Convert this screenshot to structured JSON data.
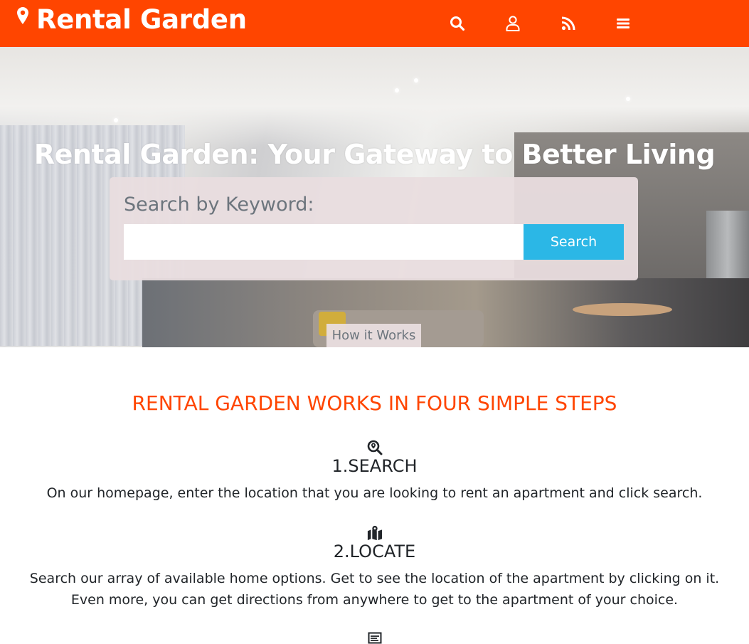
{
  "header": {
    "brand": "Rental Garden",
    "icons": [
      "map-pin-icon",
      "search-icon",
      "user-icon",
      "rss-icon",
      "menu-icon"
    ],
    "bg_color": "#ff4500"
  },
  "hero": {
    "title": "Rental Garden: Your Gateway to Better Living",
    "search_label": "Search by Keyword:",
    "search_value": "",
    "search_button": "Search",
    "how_tab": "How it Works"
  },
  "steps": {
    "heading": "RENTAL GARDEN WORKS IN FOUR SIMPLE STEPS",
    "heading_color": "#ff4500",
    "items": [
      {
        "icon": "search-location-icon",
        "title": "1.SEARCH",
        "description": "On our homepage, enter the location that you are looking to rent an apartment and click search."
      },
      {
        "icon": "map-marked-icon",
        "title": "2.LOCATE",
        "description": "Search our array of available home options. Get to see the location of the apartment by clicking on it. Even more, you can get directions from anywhere to get to the apartment of your choice."
      },
      {
        "icon": "rental-sign-icon",
        "title": "",
        "description": ""
      }
    ]
  },
  "colors": {
    "brand": "#ff4500",
    "button": "#2bb7e6"
  }
}
